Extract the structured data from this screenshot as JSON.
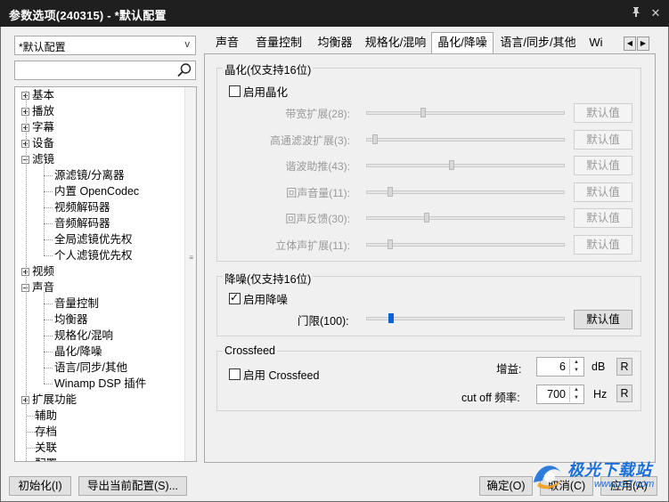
{
  "window": {
    "title": "参数选项(240315) - *默认配置",
    "pin_glyph": "⊤",
    "close_glyph": "✕"
  },
  "left": {
    "profile_combo": "*默认配置",
    "search_placeholder": "",
    "tree": [
      {
        "label": "基本",
        "level": 0,
        "expander": "plus"
      },
      {
        "label": "播放",
        "level": 0,
        "expander": "plus"
      },
      {
        "label": "字幕",
        "level": 0,
        "expander": "plus"
      },
      {
        "label": "设备",
        "level": 0,
        "expander": "plus"
      },
      {
        "label": "滤镜",
        "level": 0,
        "expander": "minus"
      },
      {
        "label": "源滤镜/分离器",
        "level": 1
      },
      {
        "label": "内置 OpenCodec",
        "level": 1
      },
      {
        "label": "视频解码器",
        "level": 1
      },
      {
        "label": "音频解码器",
        "level": 1
      },
      {
        "label": "全局滤镜优先权",
        "level": 1
      },
      {
        "label": "个人滤镜优先权",
        "level": 1
      },
      {
        "label": "视频",
        "level": 0,
        "expander": "plus"
      },
      {
        "label": "声音",
        "level": 0,
        "expander": "minus"
      },
      {
        "label": "音量控制",
        "level": 1
      },
      {
        "label": "均衡器",
        "level": 1
      },
      {
        "label": "规格化/混响",
        "level": 1
      },
      {
        "label": "晶化/降噪",
        "level": 1
      },
      {
        "label": "语言/同步/其他",
        "level": 1
      },
      {
        "label": "Winamp DSP 插件",
        "level": 1
      },
      {
        "label": "扩展功能",
        "level": 0,
        "expander": "plus"
      },
      {
        "label": "辅助",
        "level": 0
      },
      {
        "label": "存档",
        "level": 0
      },
      {
        "label": "关联",
        "level": 0
      },
      {
        "label": "配置",
        "level": 0
      }
    ]
  },
  "tabs": [
    {
      "label": "声音"
    },
    {
      "label": "音量控制"
    },
    {
      "label": "均衡器"
    },
    {
      "label": "规格化/混响"
    },
    {
      "label": "晶化/降噪"
    },
    {
      "label": "语言/同步/其他"
    },
    {
      "label": "Wi"
    }
  ],
  "crystal": {
    "group_label": "晶化(仅支持16位)",
    "enable_label": "启用晶化",
    "enabled": false,
    "sliders": [
      {
        "label": "带宽扩展(28):",
        "value": 28,
        "button": "默认值"
      },
      {
        "label": "高通滤波扩展(3):",
        "value": 3,
        "button": "默认值"
      },
      {
        "label": "谐波助推(43):",
        "value": 43,
        "button": "默认值"
      },
      {
        "label": "回声音量(11):",
        "value": 11,
        "button": "默认值"
      },
      {
        "label": "回声反馈(30):",
        "value": 30,
        "button": "默认值"
      },
      {
        "label": "立体声扩展(11):",
        "value": 11,
        "button": "默认值"
      }
    ]
  },
  "denoise": {
    "group_label": "降噪(仅支持16位)",
    "enable_label": "启用降噪",
    "enabled": true,
    "threshold_label": "门限(100):",
    "threshold_value": 100,
    "button": "默认值"
  },
  "crossfeed": {
    "group_label": "Crossfeed",
    "enable_label": "启用 Crossfeed",
    "enabled": false,
    "gain_label": "增益:",
    "gain_value": "6",
    "gain_unit": "dB",
    "cutoff_label": "cut off 频率:",
    "cutoff_value": "700",
    "cutoff_unit": "Hz",
    "reset_label": "R"
  },
  "bottom": {
    "init": "初始化(I)",
    "export": "导出当前配置(S)...",
    "ok": "确定(O)",
    "cancel": "取消(C)",
    "apply": "应用(A)"
  },
  "watermark": {
    "name": "极光下载站",
    "url": "www.xz7.com"
  },
  "colors": {
    "titlebar": "#1f1f1f",
    "slider_active": "#0a64d8",
    "watermark_blue": "#1a6fd8"
  }
}
